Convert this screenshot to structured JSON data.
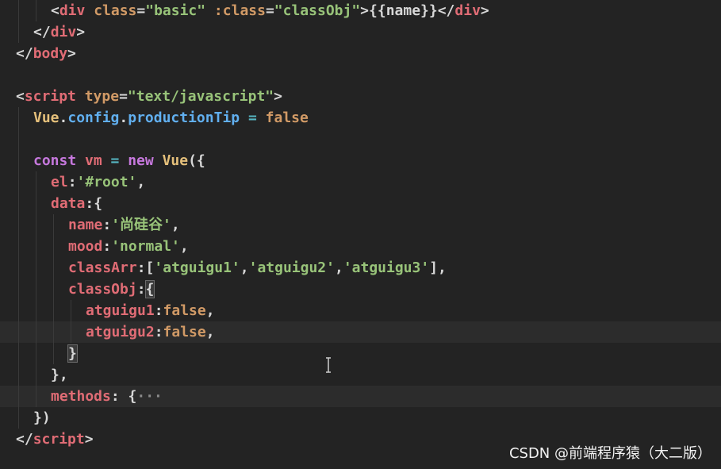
{
  "editor": {
    "lines": [
      {
        "indent": 2,
        "tokens": [
          {
            "t": "<",
            "c": "br"
          },
          {
            "t": "div",
            "c": "tag"
          },
          {
            "t": " class",
            "c": "attr"
          },
          {
            "t": "=",
            "c": "pun"
          },
          {
            "t": "\"basic\"",
            "c": "str"
          },
          {
            "t": " :class",
            "c": "attr"
          },
          {
            "t": "=",
            "c": "pun"
          },
          {
            "t": "\"classObj\"",
            "c": "str"
          },
          {
            "t": ">",
            "c": "br"
          },
          {
            "t": "{{name}}",
            "c": "txt"
          },
          {
            "t": "</",
            "c": "br"
          },
          {
            "t": "div",
            "c": "tag"
          },
          {
            "t": ">",
            "c": "br"
          }
        ]
      },
      {
        "indent": 1,
        "tokens": [
          {
            "t": "</",
            "c": "br"
          },
          {
            "t": "div",
            "c": "tag"
          },
          {
            "t": ">",
            "c": "br"
          }
        ]
      },
      {
        "indent": 0,
        "tokens": [
          {
            "t": "</",
            "c": "br"
          },
          {
            "t": "body",
            "c": "tag"
          },
          {
            "t": ">",
            "c": "br"
          }
        ]
      },
      {
        "indent": 0,
        "tokens": []
      },
      {
        "indent": 0,
        "tokens": [
          {
            "t": "<",
            "c": "br"
          },
          {
            "t": "script",
            "c": "tag"
          },
          {
            "t": " type",
            "c": "attr"
          },
          {
            "t": "=",
            "c": "pun"
          },
          {
            "t": "\"text/javascript\"",
            "c": "str"
          },
          {
            "t": ">",
            "c": "br"
          }
        ]
      },
      {
        "indent": 1,
        "tokens": [
          {
            "t": "Vue",
            "c": "cls"
          },
          {
            "t": ".",
            "c": "pun"
          },
          {
            "t": "config",
            "c": "prop"
          },
          {
            "t": ".",
            "c": "pun"
          },
          {
            "t": "productionTip",
            "c": "prop"
          },
          {
            "t": " = ",
            "c": "op"
          },
          {
            "t": "false",
            "c": "bool"
          }
        ]
      },
      {
        "indent": 1,
        "tokens": []
      },
      {
        "indent": 1,
        "tokens": [
          {
            "t": "const",
            "c": "kw"
          },
          {
            "t": " vm",
            "c": "var"
          },
          {
            "t": " = ",
            "c": "op"
          },
          {
            "t": "new",
            "c": "kw"
          },
          {
            "t": " Vue",
            "c": "cls"
          },
          {
            "t": "({",
            "c": "pun"
          }
        ]
      },
      {
        "indent": 2,
        "tokens": [
          {
            "t": "el",
            "c": "key"
          },
          {
            "t": ":",
            "c": "pun"
          },
          {
            "t": "'#root'",
            "c": "str"
          },
          {
            "t": ",",
            "c": "pun"
          }
        ]
      },
      {
        "indent": 2,
        "tokens": [
          {
            "t": "data",
            "c": "key"
          },
          {
            "t": ":{",
            "c": "pun"
          }
        ]
      },
      {
        "indent": 3,
        "tokens": [
          {
            "t": "name",
            "c": "key"
          },
          {
            "t": ":",
            "c": "pun"
          },
          {
            "t": "'尚硅谷'",
            "c": "str"
          },
          {
            "t": ",",
            "c": "pun"
          }
        ]
      },
      {
        "indent": 3,
        "tokens": [
          {
            "t": "mood",
            "c": "key"
          },
          {
            "t": ":",
            "c": "pun"
          },
          {
            "t": "'normal'",
            "c": "str"
          },
          {
            "t": ",",
            "c": "pun"
          }
        ]
      },
      {
        "indent": 3,
        "tokens": [
          {
            "t": "classArr",
            "c": "key"
          },
          {
            "t": ":[",
            "c": "pun"
          },
          {
            "t": "'atguigu1'",
            "c": "str"
          },
          {
            "t": ",",
            "c": "pun"
          },
          {
            "t": "'atguigu2'",
            "c": "str"
          },
          {
            "t": ",",
            "c": "pun"
          },
          {
            "t": "'atguigu3'",
            "c": "str"
          },
          {
            "t": "],",
            "c": "pun"
          }
        ]
      },
      {
        "indent": 3,
        "tokens": [
          {
            "t": "classObj",
            "c": "key"
          },
          {
            "t": ":",
            "c": "pun"
          },
          {
            "t": "{",
            "c": "pun",
            "match": true
          }
        ]
      },
      {
        "indent": 4,
        "tokens": [
          {
            "t": "atguigu1",
            "c": "key"
          },
          {
            "t": ":",
            "c": "pun"
          },
          {
            "t": "false",
            "c": "bool"
          },
          {
            "t": ",",
            "c": "pun"
          }
        ]
      },
      {
        "indent": 4,
        "current": true,
        "tokens": [
          {
            "t": "atguigu2",
            "c": "key"
          },
          {
            "t": ":",
            "c": "pun"
          },
          {
            "t": "false",
            "c": "bool"
          },
          {
            "t": ",",
            "c": "pun"
          }
        ]
      },
      {
        "indent": 3,
        "tokens": [
          {
            "t": "}",
            "c": "pun",
            "match": true
          }
        ]
      },
      {
        "indent": 2,
        "tokens": [
          {
            "t": "},",
            "c": "pun"
          }
        ]
      },
      {
        "indent": 2,
        "current": true,
        "tokens": [
          {
            "t": "methods",
            "c": "key"
          },
          {
            "t": ": {",
            "c": "pun"
          },
          {
            "t": "···",
            "c": "fold"
          }
        ]
      },
      {
        "indent": 1,
        "tokens": [
          {
            "t": "})",
            "c": "pun"
          }
        ]
      },
      {
        "indent": 0,
        "tokens": [
          {
            "t": "</",
            "c": "br"
          },
          {
            "t": "script",
            "c": "tag"
          },
          {
            "t": ">",
            "c": "br"
          }
        ]
      }
    ]
  },
  "watermark": "CSDN @前端程序猿（大二版）",
  "colors": {
    "background": "#232323",
    "current_line": "#2c2c2c",
    "tag": "#e06c75",
    "string": "#98c379",
    "keyword": "#c678dd",
    "class": "#e5c07b",
    "property": "#61afef"
  }
}
